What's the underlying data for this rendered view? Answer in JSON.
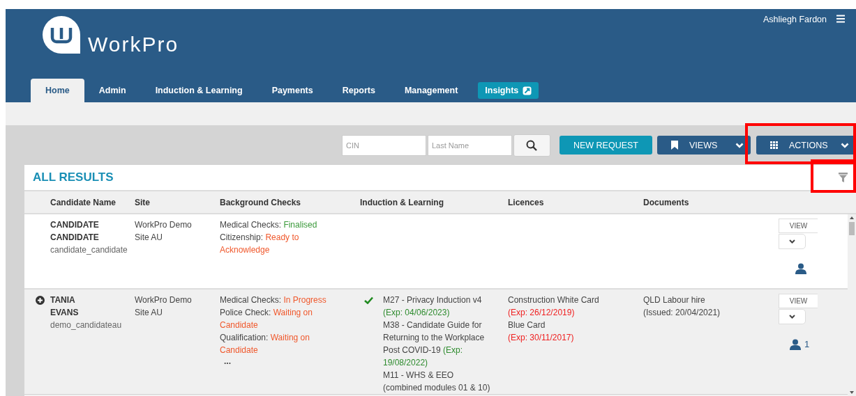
{
  "header": {
    "logo_text": "WorkPro",
    "user": "Ashliegh Fardon",
    "tabs": [
      {
        "label": "Home",
        "selected": true,
        "kind": "plain"
      },
      {
        "label": "Admin",
        "selected": false,
        "kind": "plain"
      },
      {
        "label": "Induction & Learning",
        "selected": false,
        "kind": "plain"
      },
      {
        "label": "Payments",
        "selected": false,
        "kind": "plain"
      },
      {
        "label": "Reports",
        "selected": false,
        "kind": "plain"
      },
      {
        "label": "Management",
        "selected": false,
        "kind": "plain"
      },
      {
        "label": "Insights",
        "selected": false,
        "kind": "external"
      }
    ]
  },
  "toolbar": {
    "cin": {
      "placeholder": "CIN"
    },
    "last_name": {
      "placeholder": "Last Name"
    },
    "new_request": "NEW REQUEST",
    "views": "VIEWS",
    "actions": {
      "label": "ACTIONS",
      "highlighted": true
    }
  },
  "results": {
    "title": "ALL RESULTS",
    "filter_highlighted": true,
    "columns": [
      "Candidate Name",
      "Site",
      "Background Checks",
      "Induction & Learning",
      "Licences",
      "Documents"
    ],
    "rows": [
      {
        "expander": false,
        "first_name": "CANDIDATE",
        "last_name": "CANDIDATE",
        "username": "candidate_candidate",
        "site": "WorkPro Demo Site AU",
        "checks": [
          {
            "label": "Medical Checks:",
            "status": "Finalised",
            "color": "#3c9a3c"
          },
          {
            "label": "Citizenship:",
            "status": "Ready to Acknowledge",
            "color": "#f0582c"
          }
        ],
        "induction_done": false,
        "induction": [],
        "licences": [],
        "documents": [],
        "view": "VIEW"
      },
      {
        "expander": true,
        "first_name": "TANIA",
        "last_name": "EVANS",
        "username": "demo_candidateau",
        "site": "WorkPro Demo Site AU",
        "checks": [
          {
            "label": "Medical Checks:",
            "status": "In Progress",
            "color": "#f0582c"
          },
          {
            "label": "Police Check:",
            "status": "Waiting on Candidate",
            "color": "#f0582c"
          },
          {
            "label": "Qualification:",
            "status": "Waiting on Candidate",
            "color": "#f0582c"
          }
        ],
        "more": "...",
        "induction_done": true,
        "induction": [
          {
            "title": "M27 - Privacy Induction v4",
            "exp": "(Exp: 04/06/2023)"
          },
          {
            "title": "M38 - Candidate Guide for Returning to the Workplace Post COVID-19",
            "exp": "(Exp: 19/08/2022)"
          },
          {
            "title": "M11 - WHS & EEO (combined modules 01 & 10)"
          }
        ],
        "licences": [
          {
            "name": "Construction White Card",
            "exp": "(Exp: 26/12/2019)"
          },
          {
            "name": "Blue Card",
            "exp": "(Exp: 30/11/2017)"
          }
        ],
        "documents": [
          {
            "name": "QLD Labour hire",
            "issued": "(Issued: 20/04/2021)"
          }
        ],
        "view": "VIEW",
        "count": "1"
      }
    ]
  }
}
